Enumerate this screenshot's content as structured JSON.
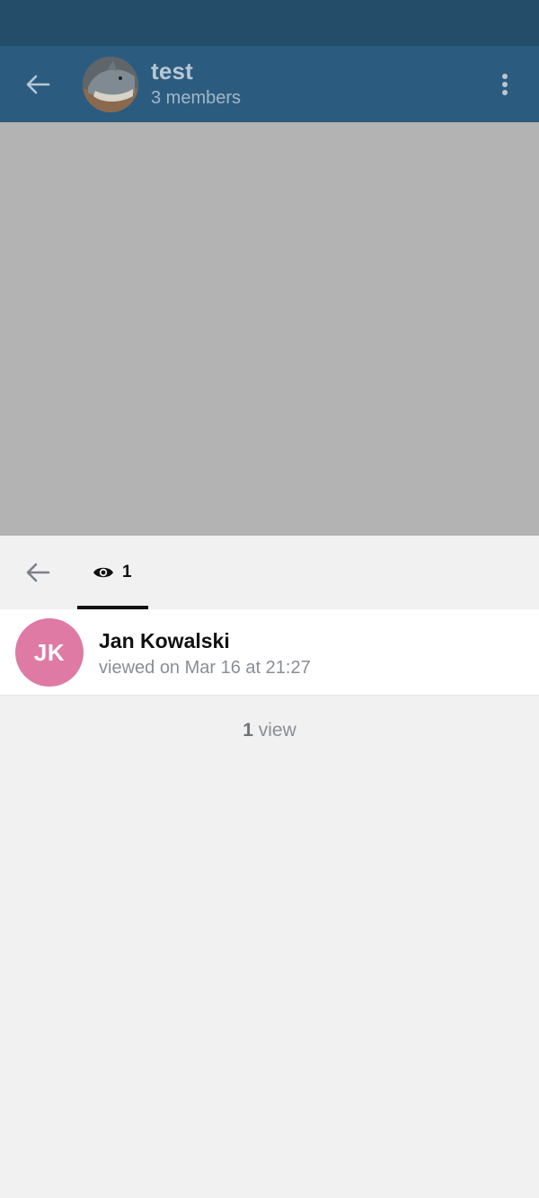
{
  "header": {
    "title": "test",
    "subtitle": "3 members",
    "back_icon": "arrow-left-icon",
    "menu_icon": "more-vertical-icon"
  },
  "sheet": {
    "back_icon": "arrow-left-icon",
    "tab_icon": "eye-icon",
    "tab_count": "1"
  },
  "viewers": [
    {
      "initials": "JK",
      "name": "Jan Kowalski",
      "time": "viewed on Mar 16 at 21:27",
      "avatar_color": "#de7aa4"
    }
  ],
  "summary": {
    "count": "1",
    "label": "view"
  },
  "colors": {
    "status_bar": "#234d69",
    "header": "#2b5c80",
    "dim": "#b3b3b3",
    "sheet_bg": "#f1f1f1"
  }
}
